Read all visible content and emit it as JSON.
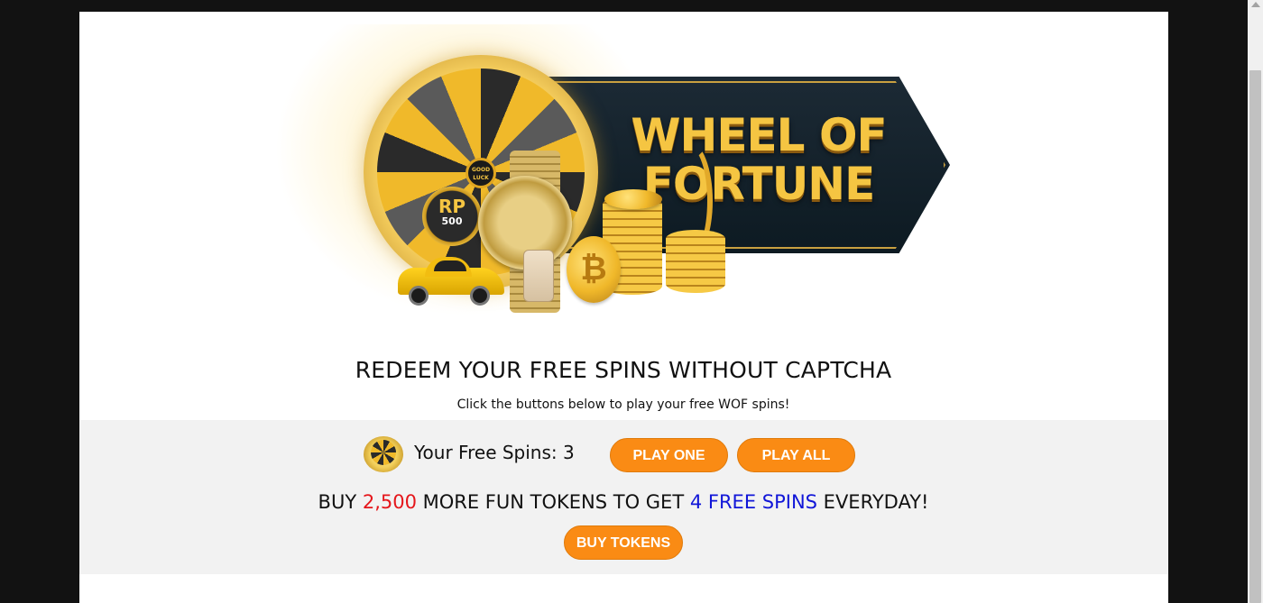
{
  "banner": {
    "title_line1": "WHEEL OF",
    "title_line2": "FORTUNE",
    "hub_label": "GOOD LUCK",
    "badge_rp": "RP",
    "badge_amount": "500"
  },
  "headline": "REDEEM YOUR FREE SPINS WITHOUT CAPTCHA",
  "subline": "Click the buttons below to play your free WOF spins!",
  "spins": {
    "label": "Your Free Spins: 3"
  },
  "buttons": {
    "play_one": "PLAY ONE",
    "play_all": "PLAY ALL",
    "buy_tokens": "BUY TOKENS"
  },
  "promo": {
    "part1": "BUY ",
    "amount": "2,500",
    "part2": " MORE FUN TOKENS TO GET ",
    "highlight": "4 FREE SPINS",
    "part3": " EVERYDAY!"
  },
  "colors": {
    "accent": "#fa8b14",
    "promo_amount": "#e5161b",
    "promo_highlight": "#1116d8"
  }
}
